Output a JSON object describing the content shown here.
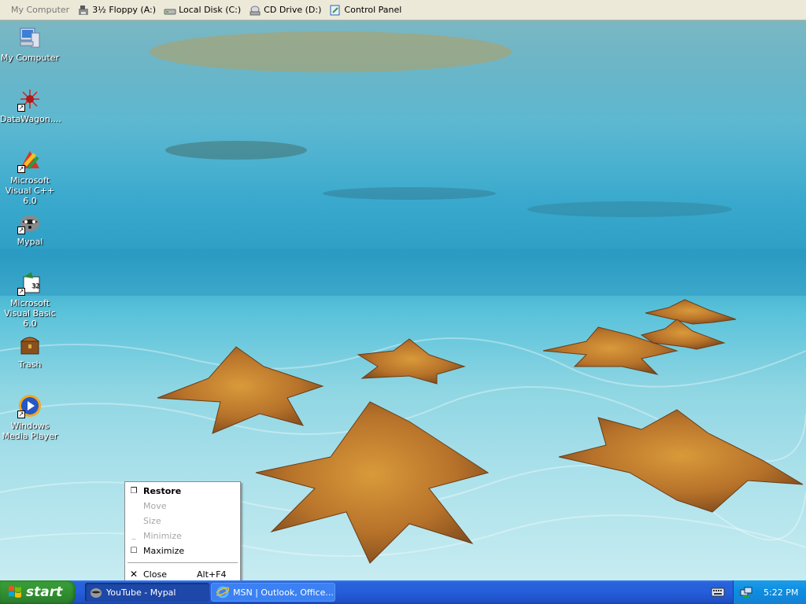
{
  "toolbar": {
    "items": [
      {
        "label": "My Computer",
        "icon": "my-computer-icon"
      },
      {
        "label": "3½ Floppy (A:)",
        "icon": "floppy-icon"
      },
      {
        "label": "Local Disk (C:)",
        "icon": "disk-icon"
      },
      {
        "label": "CD Drive (D:)",
        "icon": "cd-icon"
      },
      {
        "label": "Control Panel",
        "icon": "control-panel-icon"
      }
    ]
  },
  "desktop": {
    "icons": [
      {
        "label": "My Computer",
        "icon": "my-computer-icon"
      },
      {
        "label": "DataWagon....",
        "icon": "datawagon-icon"
      },
      {
        "label": "Microsoft Visual C++ 6.0",
        "icon": "visual-cpp-icon"
      },
      {
        "label": "Mypal",
        "icon": "mypal-icon"
      },
      {
        "label": "Microsoft Visual Basic 6.0",
        "icon": "visual-basic-icon"
      },
      {
        "label": "Trash",
        "icon": "trash-icon"
      },
      {
        "label": "Windows Media Player",
        "icon": "media-player-icon"
      }
    ]
  },
  "context_menu": {
    "items": [
      {
        "label": "Restore",
        "enabled": true,
        "bold": true,
        "icon": "restore-icon"
      },
      {
        "label": "Move",
        "enabled": false
      },
      {
        "label": "Size",
        "enabled": false
      },
      {
        "label": "Minimize",
        "enabled": false,
        "icon": "minimize-icon"
      },
      {
        "label": "Maximize",
        "enabled": true,
        "icon": "maximize-icon"
      },
      {
        "label": "Close",
        "enabled": true,
        "icon": "close-icon",
        "accelerator": "Alt+F4"
      }
    ]
  },
  "taskbar": {
    "start_label": "start",
    "tasks": [
      {
        "label": "YouTube - Mypal",
        "icon": "mypal-icon",
        "active": true
      },
      {
        "label": "MSN | Outlook, Office...",
        "icon": "ie-icon",
        "active": false
      }
    ],
    "clock": "5:22 PM"
  },
  "colors": {
    "taskbar": "#245edb",
    "start_button": "#389e38",
    "menu_bg": "#ffffff"
  }
}
